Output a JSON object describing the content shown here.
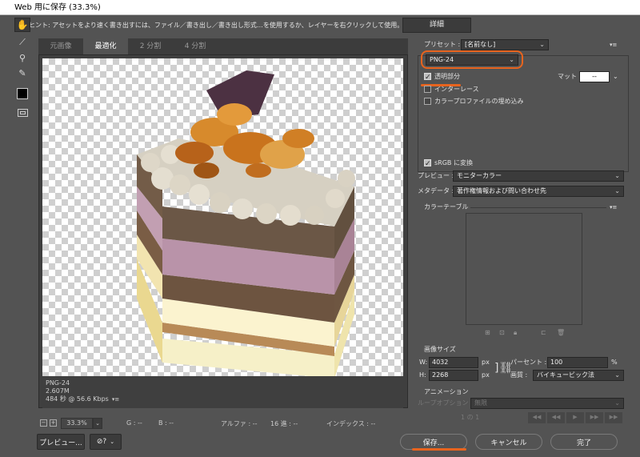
{
  "window": {
    "title": "Web 用に保存 (33.3%)"
  },
  "hint": {
    "text": "ヒント: アセットをより速く書き出すには、ファイル／書き出し／書き出し形式…を使用するか、レイヤーを右クリックして使用。",
    "detail_button": "詳細"
  },
  "tabs": [
    {
      "label": "元画像"
    },
    {
      "label": "最適化"
    },
    {
      "label": "2 分割"
    },
    {
      "label": "4 分割"
    }
  ],
  "info": {
    "format": "PNG-24",
    "size": "2.607M",
    "time": "484 秒 @ 56.6 Kbps"
  },
  "status": {
    "zoom": "33.3%",
    "g": "G : --",
    "b": "B : --",
    "alpha": "アルファ : --",
    "hex": "16 進 : --",
    "index": "インデックス : --"
  },
  "buttons": {
    "preview": "プレビュー...",
    "save": "保存...",
    "cancel": "キャンセル",
    "done": "完了"
  },
  "settings": {
    "preset_label": "プリセット :",
    "preset_value": "[名前なし]",
    "format_value": "PNG-24",
    "transparency_label": "透明部分",
    "matte_label": "マット :",
    "matte_value": "--",
    "interlace_label": "インターレース",
    "embed_profile_label": "カラープロファイルの埋め込み",
    "srgb_label": "sRGB に変換",
    "preview_label": "プレビュー :",
    "preview_value": "モニターカラー",
    "metadata_label": "メタデータ :",
    "metadata_value": "著作権情報および問い合わせ先"
  },
  "color_table": {
    "title": "カラーテーブル"
  },
  "image_size": {
    "title": "画像サイズ",
    "w_label": "W:",
    "w_value": "4032",
    "h_label": "H:",
    "h_value": "2268",
    "unit": "px",
    "percent_label": "パーセント :",
    "percent_value": "100",
    "percent_unit": "%",
    "quality_label": "画質 :",
    "quality_value": "バイキュービック法"
  },
  "animation": {
    "title": "アニメーション",
    "loop_label": "ループオプション :",
    "loop_value": "無限",
    "frame_counter": "1 の 1"
  },
  "colors": {
    "highlight": "#e8641e"
  }
}
